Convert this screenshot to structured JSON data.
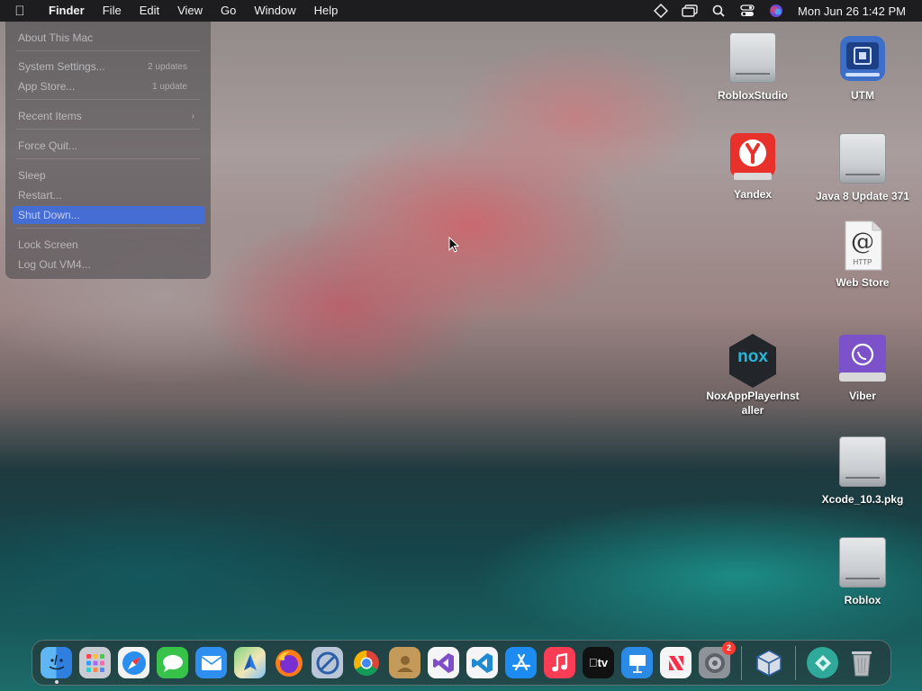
{
  "menubar": {
    "app_name": "Finder",
    "menus": [
      "File",
      "Edit",
      "View",
      "Go",
      "Window",
      "Help"
    ],
    "clock": "Mon Jun 26  1:42 PM",
    "status_icons": [
      "vpn-diamond-icon",
      "window-switch-icon",
      "search-icon",
      "control-center-icon",
      "siri-icon"
    ]
  },
  "apple_menu": {
    "about": "About This Mac",
    "system_settings": "System Settings...",
    "system_settings_badge": "2 updates",
    "app_store": "App Store...",
    "app_store_badge": "1 update",
    "recent_items": "Recent Items",
    "recent_arrow": "›",
    "force_quit": "Force Quit...",
    "sleep": "Sleep",
    "restart": "Restart...",
    "shut_down": "Shut Down...",
    "lock_screen": "Lock Screen",
    "log_out": "Log Out VM4..."
  },
  "desktop": {
    "roblox_studio": "RobloxStudio",
    "utm": "UTM",
    "yandex": "Yandex",
    "java": "Java 8 Update 371",
    "web_store": "Web Store",
    "web_store_glyph": "@",
    "web_store_tag": "HTTP",
    "nox_line1": "NoxAppPlayerInst",
    "nox_line2": "aller",
    "nox_glyph": "nox",
    "viber": "Viber",
    "xcode": "Xcode_10.3.pkg",
    "roblox": "Roblox"
  },
  "dock": {
    "settings_badge": "2",
    "tv_label": "tv",
    "items": [
      "finder",
      "launchpad",
      "safari",
      "messages",
      "mail",
      "maps",
      "firefox",
      "system-preferences-blocked",
      "chrome",
      "contacts",
      "visual-studio",
      "vscode",
      "app-store",
      "music",
      "apple-tv",
      "keynote",
      "news",
      "system-settings",
      "virtualbox",
      "unknown-app",
      "trash"
    ]
  }
}
